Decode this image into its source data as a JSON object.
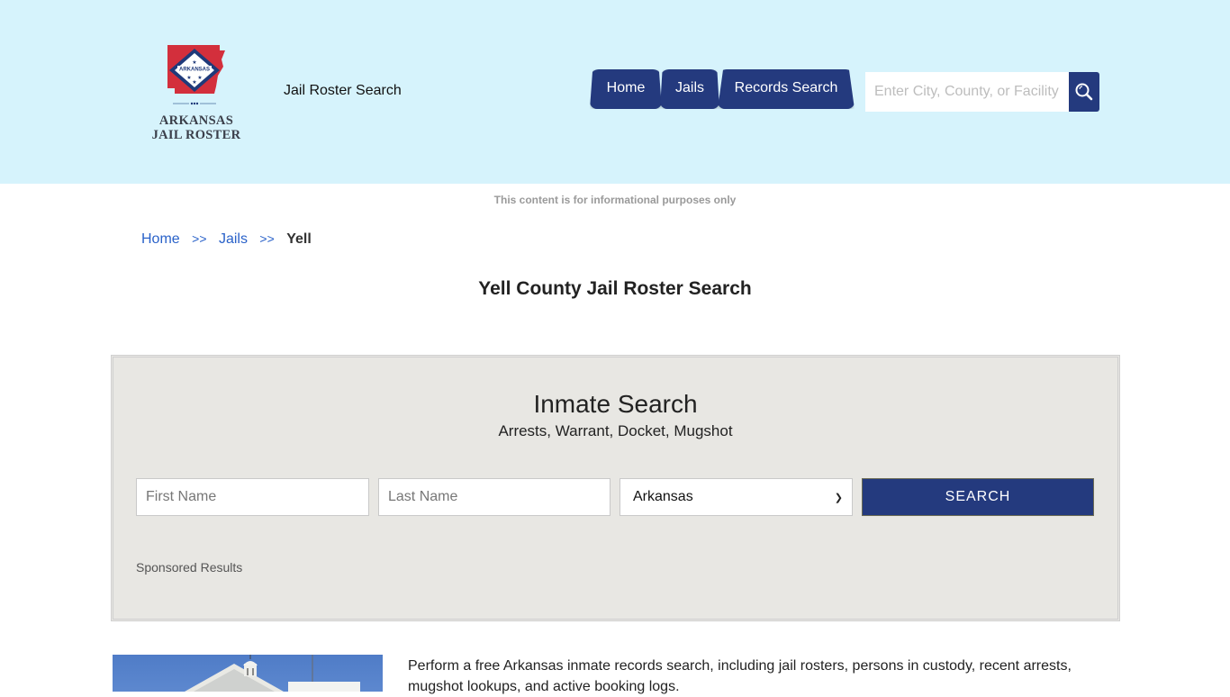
{
  "header": {
    "logo": {
      "line1": "ARKANSAS",
      "line2": "JAIL ROSTER",
      "flag_text": "ARKANSAS",
      "icon": "arkansas-flag-map-icon"
    },
    "tagline": "Jail Roster Search",
    "nav": [
      {
        "label": "Home"
      },
      {
        "label": "Jails"
      },
      {
        "label": "Records Search"
      }
    ],
    "search": {
      "placeholder": "Enter City, County, or Facility",
      "value": "",
      "icon": "search-icon"
    }
  },
  "disclaimer": "This content is for informational purposes only",
  "breadcrumb": {
    "items": [
      {
        "label": "Home"
      },
      {
        "label": "Jails"
      }
    ],
    "separator": ">>",
    "current": "Yell"
  },
  "page_title": "Yell County Jail Roster Search",
  "inmate_search": {
    "title": "Inmate Search",
    "subtitle": "Arrests, Warrant, Docket, Mugshot",
    "first_name": {
      "placeholder": "First Name",
      "value": ""
    },
    "last_name": {
      "placeholder": "Last Name",
      "value": ""
    },
    "state": {
      "selected": "Arkansas"
    },
    "button_label": "SEARCH",
    "sponsored_label": "Sponsored Results"
  },
  "intro_text": "Perform a free Arkansas inmate records search, including jail rosters, persons in custody, recent arrests, mugshot lookups, and active booking logs.",
  "colors": {
    "header_bg": "#d6f3fc",
    "brand_navy": "#243a7e",
    "link_blue": "#2a62c9",
    "panel_bg": "#e8e7e3"
  }
}
